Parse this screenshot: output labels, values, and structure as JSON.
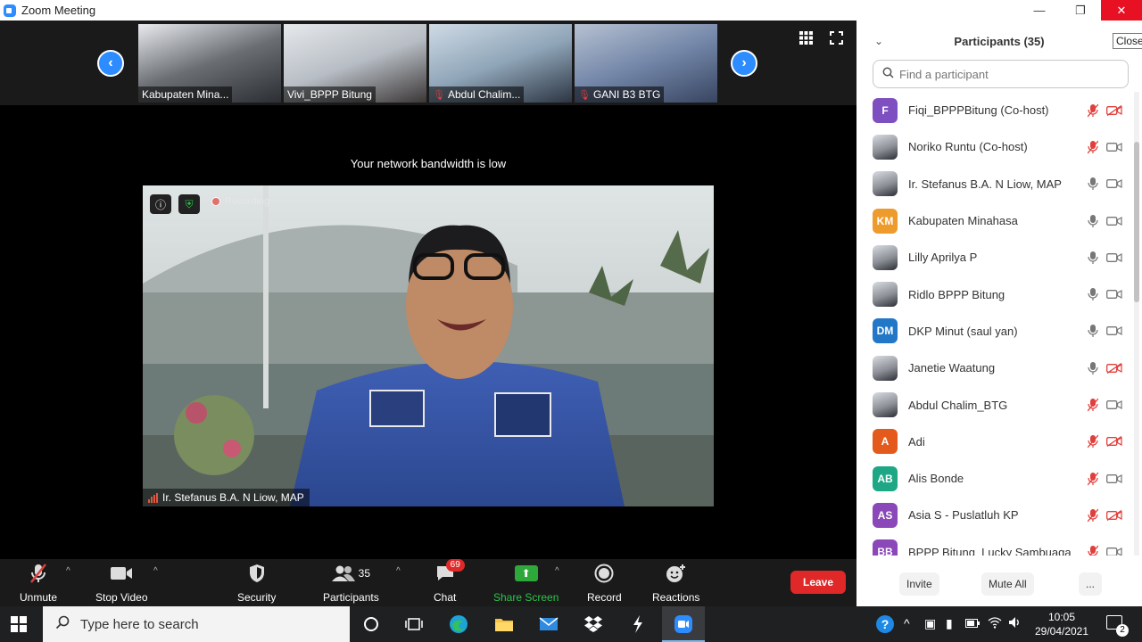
{
  "window": {
    "title": "Zoom Meeting",
    "minimize": "—",
    "maximize": "❐",
    "close": "✕",
    "close_tooltip": "Close"
  },
  "thumbnails": [
    {
      "name": "Kabupaten Mina...",
      "muted": false,
      "colors": [
        "#e8eaee",
        "#6a6e73",
        "#2b2e33"
      ]
    },
    {
      "name": "Vivi_BPPP Bitung",
      "muted": false,
      "colors": [
        "#e6e9ec",
        "#b7bdc4",
        "#3b3636"
      ]
    },
    {
      "name": "Abdul Chalim...",
      "muted": true,
      "colors": [
        "#cfdbe6",
        "#8fa5b8",
        "#2c3543"
      ]
    },
    {
      "name": "GANI B3 BTG",
      "muted": true,
      "colors": [
        "#b6c1d2",
        "#7386a8",
        "#384561"
      ]
    }
  ],
  "bandwidth_warning": "Your network bandwidth is low",
  "main_video": {
    "speaker": "Ir. Stefanus B.A. N Liow, MAP",
    "recording": "Recording"
  },
  "toolbar": {
    "unmute": "Unmute",
    "stop_video": "Stop Video",
    "security": "Security",
    "participants": "Participants",
    "participants_count": "35",
    "chat": "Chat",
    "chat_badge": "69",
    "share_screen": "Share Screen",
    "record": "Record",
    "reactions": "Reactions",
    "leave": "Leave"
  },
  "panel": {
    "title": "Participants (35)",
    "search_placeholder": "Find a participant",
    "invite": "Invite",
    "mute_all": "Mute All",
    "more": "..."
  },
  "participants": [
    {
      "initials": "F",
      "name": "Fiqi_BPPPBitung (Co-host)",
      "color": "#7e4fc0",
      "photo": false,
      "mic_off": true,
      "cam_off": true
    },
    {
      "initials": "",
      "name": "Noriko Runtu (Co-host)",
      "color": "#1f5a9e",
      "photo": true,
      "mic_off": true,
      "cam_off": false
    },
    {
      "initials": "",
      "name": "Ir. Stefanus B.A. N Liow, MAP",
      "color": "#777",
      "photo": true,
      "mic_off": false,
      "cam_off": false
    },
    {
      "initials": "KM",
      "name": "Kabupaten Minahasa",
      "color": "#ed9b2c",
      "photo": false,
      "mic_off": false,
      "cam_off": false
    },
    {
      "initials": "",
      "name": "Lilly Aprilya P",
      "color": "#777",
      "photo": true,
      "mic_off": false,
      "cam_off": false
    },
    {
      "initials": "",
      "name": "Ridlo BPPP Bitung",
      "color": "#777",
      "photo": true,
      "mic_off": false,
      "cam_off": false
    },
    {
      "initials": "DM",
      "name": "DKP Minut (saul yan)",
      "color": "#2278c7",
      "photo": false,
      "mic_off": false,
      "cam_off": false
    },
    {
      "initials": "",
      "name": "Janetie Waatung",
      "color": "#777",
      "photo": true,
      "mic_off": false,
      "cam_off": true
    },
    {
      "initials": "",
      "name": "Abdul Chalim_BTG",
      "color": "#111",
      "photo": true,
      "mic_off": true,
      "cam_off": false
    },
    {
      "initials": "A",
      "name": "Adi",
      "color": "#e35a1c",
      "photo": false,
      "mic_off": true,
      "cam_off": true
    },
    {
      "initials": "AB",
      "name": "Alis Bonde",
      "color": "#1ea785",
      "photo": false,
      "mic_off": true,
      "cam_off": false
    },
    {
      "initials": "AS",
      "name": "Asia S - Puslatluh KP",
      "color": "#8a48b8",
      "photo": false,
      "mic_off": true,
      "cam_off": true
    },
    {
      "initials": "BB",
      "name": "BPPP Bitung_Lucky Sambuaga",
      "color": "#8a48b8",
      "photo": false,
      "mic_off": true,
      "cam_off": false
    }
  ],
  "taskbar": {
    "search_placeholder": "Type here to search",
    "time": "10:05",
    "date": "29/04/2021",
    "notifications": "2"
  }
}
